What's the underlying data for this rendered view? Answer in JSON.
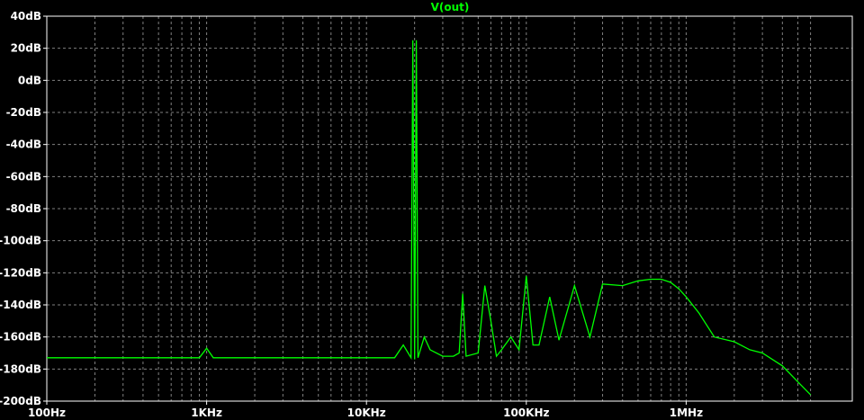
{
  "chart_data": {
    "type": "line",
    "title": "V(out)",
    "xscale": "log",
    "xlim": [
      100,
      6000000
    ],
    "ylim": [
      -200,
      40
    ],
    "grid": true,
    "x_ticks": [
      {
        "value": 100,
        "label": "100Hz"
      },
      {
        "value": 1000,
        "label": "1KHz"
      },
      {
        "value": 10000,
        "label": "10KHz"
      },
      {
        "value": 100000,
        "label": "100KHz"
      },
      {
        "value": 1000000,
        "label": "1MHz"
      }
    ],
    "y_ticks": [
      {
        "value": 40,
        "label": "40dB"
      },
      {
        "value": 20,
        "label": "20dB"
      },
      {
        "value": 0,
        "label": "0dB"
      },
      {
        "value": -20,
        "label": "-20dB"
      },
      {
        "value": -40,
        "label": "-40dB"
      },
      {
        "value": -60,
        "label": "-60dB"
      },
      {
        "value": -80,
        "label": "-80dB"
      },
      {
        "value": -100,
        "label": "-100dB"
      },
      {
        "value": -120,
        "label": "-120dB"
      },
      {
        "value": -140,
        "label": "-140dB"
      },
      {
        "value": -160,
        "label": "-160dB"
      },
      {
        "value": -180,
        "label": "-180dB"
      },
      {
        "value": -200,
        "label": "-200dB"
      }
    ],
    "colors": {
      "series": "#00ff00",
      "axis": "#ffffff",
      "grid": "#808080",
      "background": "#000000"
    },
    "series": [
      {
        "name": "V(out)",
        "x": [
          100,
          900,
          1000,
          1100,
          2000,
          5000,
          10000,
          15000,
          17000,
          19000,
          19500,
          20000,
          20500,
          21000,
          23000,
          25000,
          30000,
          35000,
          38000,
          40000,
          42000,
          50000,
          55000,
          60000,
          65000,
          70000,
          80000,
          90000,
          100000,
          110000,
          120000,
          140000,
          160000,
          200000,
          250000,
          300000,
          400000,
          500000,
          600000,
          700000,
          800000,
          900000,
          1000000,
          1200000,
          1500000,
          2000000,
          2500000,
          3000000,
          4000000,
          5000000,
          6000000
        ],
        "y": [
          -173,
          -173,
          -167,
          -173,
          -173,
          -173,
          -173,
          -173,
          -165,
          -173,
          25,
          -174,
          25,
          -173,
          -160,
          -168,
          -172,
          -172,
          -170,
          -133,
          -172,
          -170,
          -128,
          -150,
          -172,
          -168,
          -160,
          -168,
          -122,
          -165,
          -165,
          -135,
          -162,
          -128,
          -160,
          -127,
          -128,
          -125,
          -124,
          -124,
          -126,
          -130,
          -135,
          -145,
          -160,
          -163,
          -168,
          -170,
          -178,
          -188,
          -196
        ]
      }
    ]
  }
}
